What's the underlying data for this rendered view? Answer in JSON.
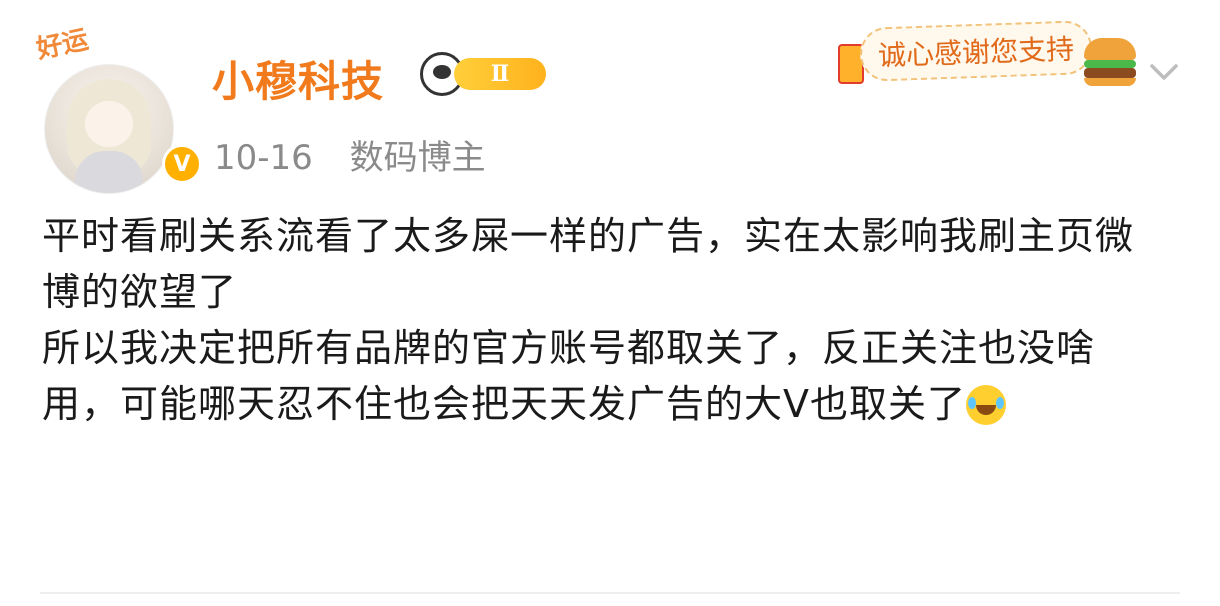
{
  "post": {
    "author": {
      "name": "小穆科技",
      "avatar_badge_text": "好运",
      "verified_badge": "V",
      "level_badge": "Ⅱ"
    },
    "meta": {
      "time": "10-16",
      "source_tag": "数码博主"
    },
    "header_card": {
      "thanks_text": "诚心感谢您支持"
    },
    "content": {
      "paragraphs": [
        "平时看刷关系流看了太多屎一样的广告，实在太影响我刷主页微博的欲望了",
        "所以我决定把所有品牌的官方账号都取关了，反正关注也没啥用，可能哪天忍不住也会把天天发广告的大V也取关了"
      ]
    }
  },
  "colors": {
    "author_name": "#f07a1c",
    "meta_text": "#8a8a8a",
    "body_text": "#1a1a1a",
    "verified_badge": "#ffb000"
  },
  "icons": {
    "emoji": "laugh-cry-emoji",
    "more": "chevron-down-icon"
  }
}
